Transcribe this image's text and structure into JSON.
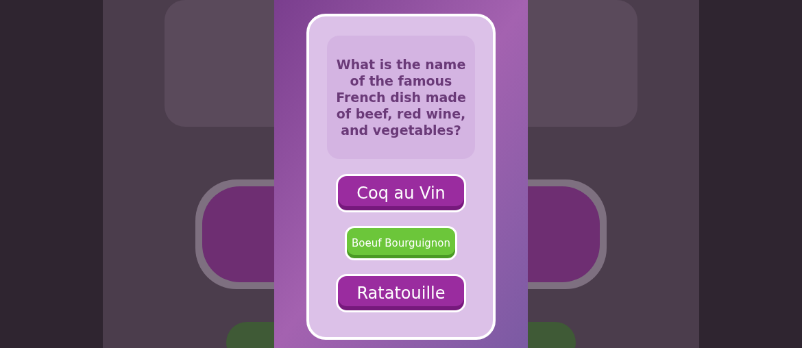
{
  "question": "What is the name of the famous French dish made of beef, red wine, and vegetables?",
  "answers": [
    {
      "label": "Coq au Vin",
      "selected": false
    },
    {
      "label": "Boeuf Bourguignon",
      "selected": true
    },
    {
      "label": "Ratatouille",
      "selected": false
    }
  ]
}
